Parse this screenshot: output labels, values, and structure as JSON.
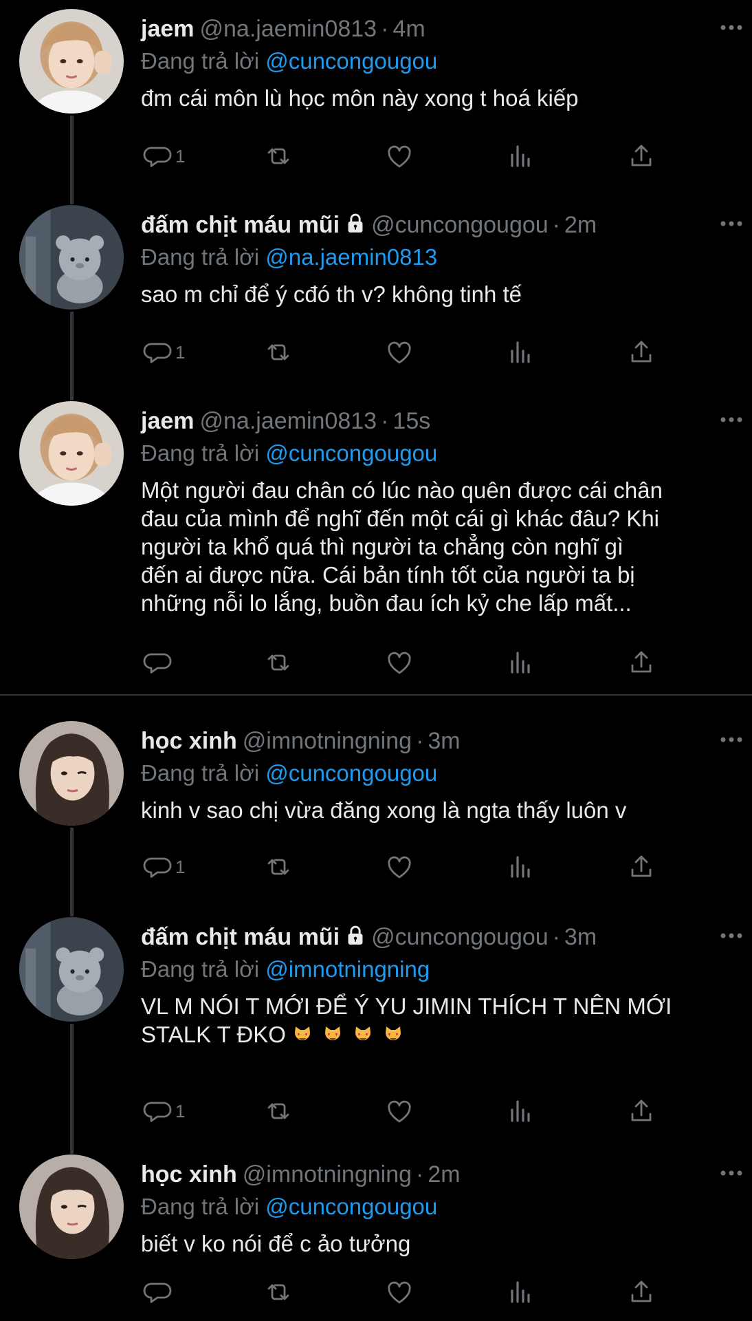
{
  "tweets": [
    {
      "display_name": "jaem",
      "locked": false,
      "handle": "@na.jaemin0813",
      "dot": "·",
      "time": "4m",
      "reply_prefix": "Đang trả lời",
      "reply_to": "@cuncongougou",
      "text": "đm cái môn lù học môn này xong t hoá kiếp",
      "reply_count": "1",
      "avatar": "boy-avatar"
    },
    {
      "display_name": "đấm chịt máu mũi",
      "locked": true,
      "handle": "@cuncongougou",
      "dot": "·",
      "time": "2m",
      "reply_prefix": "Đang trả lời",
      "reply_to": "@na.jaemin0813",
      "text": "sao m chỉ để ý cđó th v? không tinh tế",
      "reply_count": "1",
      "avatar": "plush-bear-avatar"
    },
    {
      "display_name": "jaem",
      "locked": false,
      "handle": "@na.jaemin0813",
      "dot": "·",
      "time": "15s",
      "reply_prefix": "Đang trả lời",
      "reply_to": "@cuncongougou",
      "text": "Một người đau chân có lúc nào quên được cái chân\nđau của mình để nghĩ đến một cái gì khác đâu? Khi\nngười ta khổ quá thì người ta chẳng còn nghĩ gì\nđến ai được nữa. Cái bản tính tốt của người ta bị\nnhững nỗi lo lắng, buồn đau ích kỷ che lấp mất...",
      "reply_count": "",
      "avatar": "boy-avatar"
    },
    {
      "display_name": "học xinh",
      "locked": false,
      "handle": "@imnotningning",
      "dot": "·",
      "time": "3m",
      "reply_prefix": "Đang trả lời",
      "reply_to": "@cuncongougou",
      "text": "kinh v sao chị vừa đăng xong là ngta thấy luôn v",
      "reply_count": "1",
      "avatar": "girl-avatar"
    },
    {
      "display_name": "đấm chịt máu mũi",
      "locked": true,
      "handle": "@cuncongougou",
      "dot": "·",
      "time": "3m",
      "reply_prefix": "Đang trả lời",
      "reply_to": "@imnotningning",
      "text": "VL M NÓI T MỚI ĐỂ Ý YU JIMIN THÍCH T NÊN MỚI\nSTALK T ĐKO",
      "emojis": [
        "smiling-cat-heart-eyes",
        "smiling-cat-heart-eyes",
        "smiling-cat-heart-eyes",
        "smiling-cat-heart-eyes"
      ],
      "reply_count": "1",
      "avatar": "plush-bear-avatar"
    },
    {
      "display_name": "học xinh",
      "locked": false,
      "handle": "@imnotningning",
      "dot": "·",
      "time": "2m",
      "reply_prefix": "Đang trả lời",
      "reply_to": "@cuncongougou",
      "text": "biết v ko nói để c ảo tưởng",
      "reply_count": "",
      "avatar": "girl-avatar"
    }
  ],
  "colors": {
    "background": "#000000",
    "text": "#e7e9ea",
    "secondary": "#71767b",
    "link": "#1d9bf0",
    "thread_line": "#333639"
  },
  "icons": [
    "reply-icon",
    "retweet-icon",
    "like-icon",
    "views-icon",
    "share-icon",
    "more-icon",
    "lock-icon"
  ]
}
